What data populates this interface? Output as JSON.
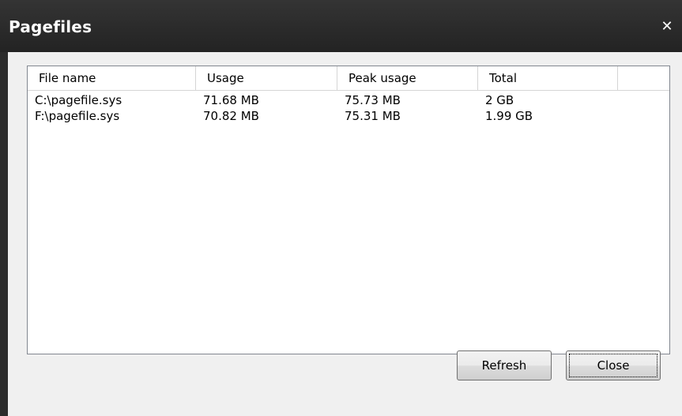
{
  "window": {
    "title": "Pagefiles",
    "close_glyph": "✕"
  },
  "table": {
    "columns": [
      "File name",
      "Usage",
      "Peak usage",
      "Total"
    ],
    "rows": [
      [
        "C:\\pagefile.sys",
        "71.68 MB",
        "75.73 MB",
        "2 GB"
      ],
      [
        "F:\\pagefile.sys",
        "70.82 MB",
        "75.31 MB",
        "1.99 GB"
      ]
    ]
  },
  "buttons": {
    "refresh_label": "Refresh",
    "close_label": "Close"
  },
  "colors": {
    "titlebar": "#2b2b2b",
    "client": "#f0f0f0",
    "list_background": "#ffffff"
  }
}
